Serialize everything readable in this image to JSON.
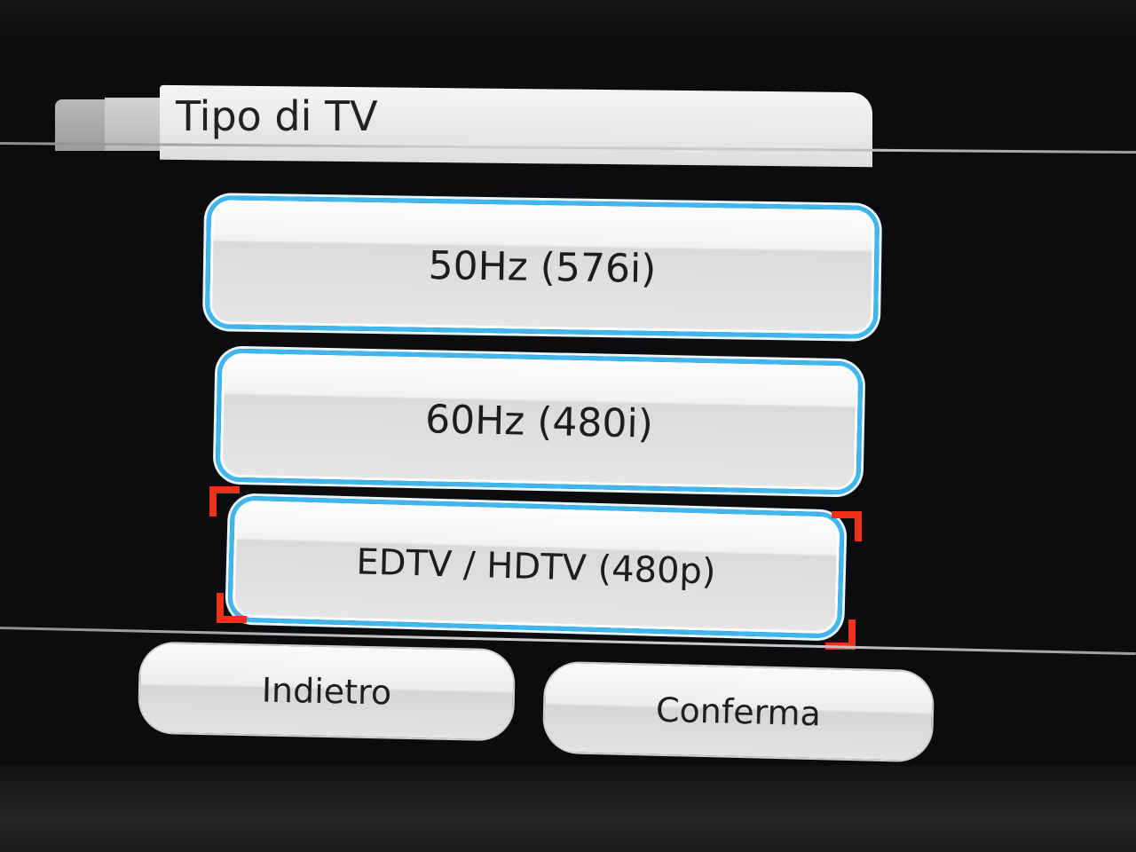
{
  "header": {
    "title": "Tipo di TV"
  },
  "options": [
    {
      "label": "50Hz (576i)",
      "selected": false
    },
    {
      "label": "60Hz (480i)",
      "selected": false
    },
    {
      "label": "EDTV / HDTV (480p)",
      "selected": true
    }
  ],
  "footer": {
    "back_label": "Indietro",
    "confirm_label": "Conferma"
  },
  "colors": {
    "option_border": "#3fb6ee",
    "selection_cursor": "#ee3118"
  }
}
